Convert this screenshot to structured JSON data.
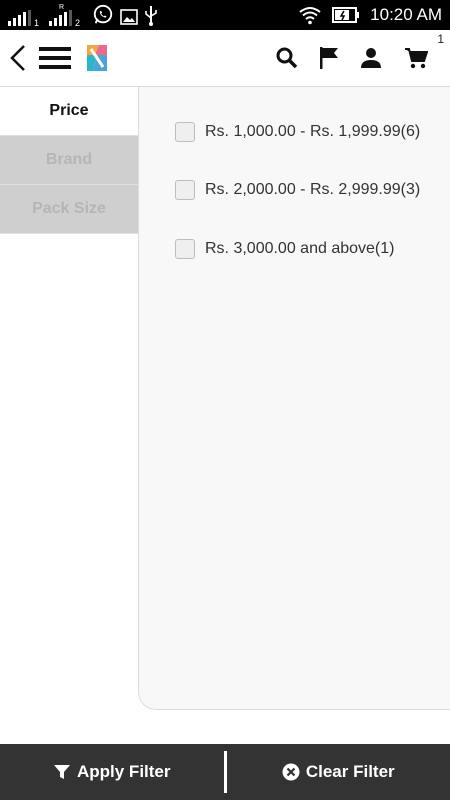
{
  "status_bar": {
    "sim1_label": "1",
    "sim2_label": "2",
    "time": "10:20 AM"
  },
  "app_bar": {
    "cart_count": "1"
  },
  "filter_tabs": [
    {
      "label": "Price",
      "active": true
    },
    {
      "label": "Brand",
      "active": false
    },
    {
      "label": "Pack Size",
      "active": false
    }
  ],
  "price_options": [
    {
      "label": "Rs. 1,000.00 - Rs. 1,999.99(6)",
      "checked": false
    },
    {
      "label": "Rs. 2,000.00 - Rs. 2,999.99(3)",
      "checked": false
    },
    {
      "label": "Rs. 3,000.00 and above(1)",
      "checked": false
    }
  ],
  "bottom_bar": {
    "apply_label": "Apply Filter",
    "clear_label": "Clear Filter"
  },
  "icons": [
    "back-arrow-icon",
    "menu-icon",
    "app-logo",
    "search-icon",
    "flag-icon",
    "user-icon",
    "cart-icon",
    "filter-icon",
    "clear-icon"
  ],
  "colors": {
    "bottom_bar": "#333333",
    "inactive_tab": "#cfcfcf",
    "panel": "#f8f8f8"
  }
}
